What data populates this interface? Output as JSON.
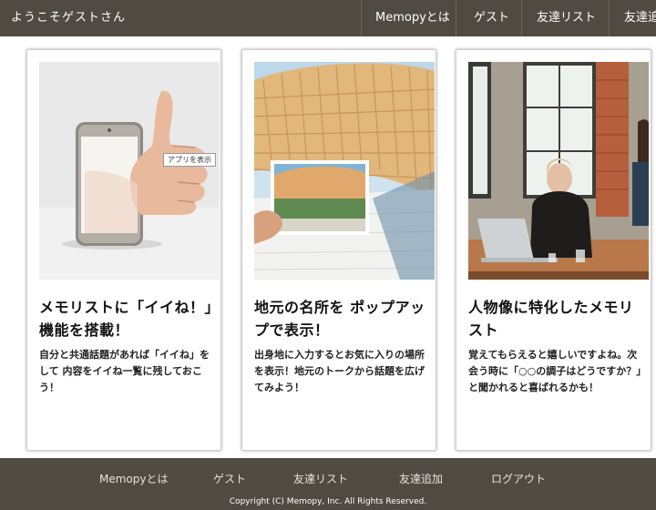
{
  "header": {
    "brand": "ようこそゲストさん",
    "nav": [
      "Memopyとは",
      "ゲスト",
      "友達リスト",
      "友達追加"
    ]
  },
  "cards": [
    {
      "title": "メモリストに「イイね！」機能を搭載！",
      "text": "自分と共通話題があれば「イイね」をして 内容をイイね一覧に残しておこう！",
      "image": "thumbs-up-phone-photo"
    },
    {
      "title": "地元の名所を ポップアップで表示！",
      "text": "出身地に入力するとお気に入りの場所を表示！地元のトークから話題を広げてみよう！",
      "image": "architecture-postcard-photo"
    },
    {
      "title": "人物像に特化したメモリスト",
      "text": "覚えてもらえると嬉しいですよね。次会う時に「○○の調子はどうですか？」と聞かれると喜ばれるかも！",
      "image": "cafe-woman-laptop-photo"
    }
  ],
  "tooltip": "アプリを表示",
  "footer": {
    "links": [
      "Memopyとは",
      "ゲスト",
      "友達リスト",
      "友達追加",
      "ログアウト"
    ],
    "copyright": "Copyright (C) Memopy, Inc. All Rights Reserved."
  },
  "colors": {
    "bar": "#4f4a42",
    "text_light": "#ffffff"
  }
}
